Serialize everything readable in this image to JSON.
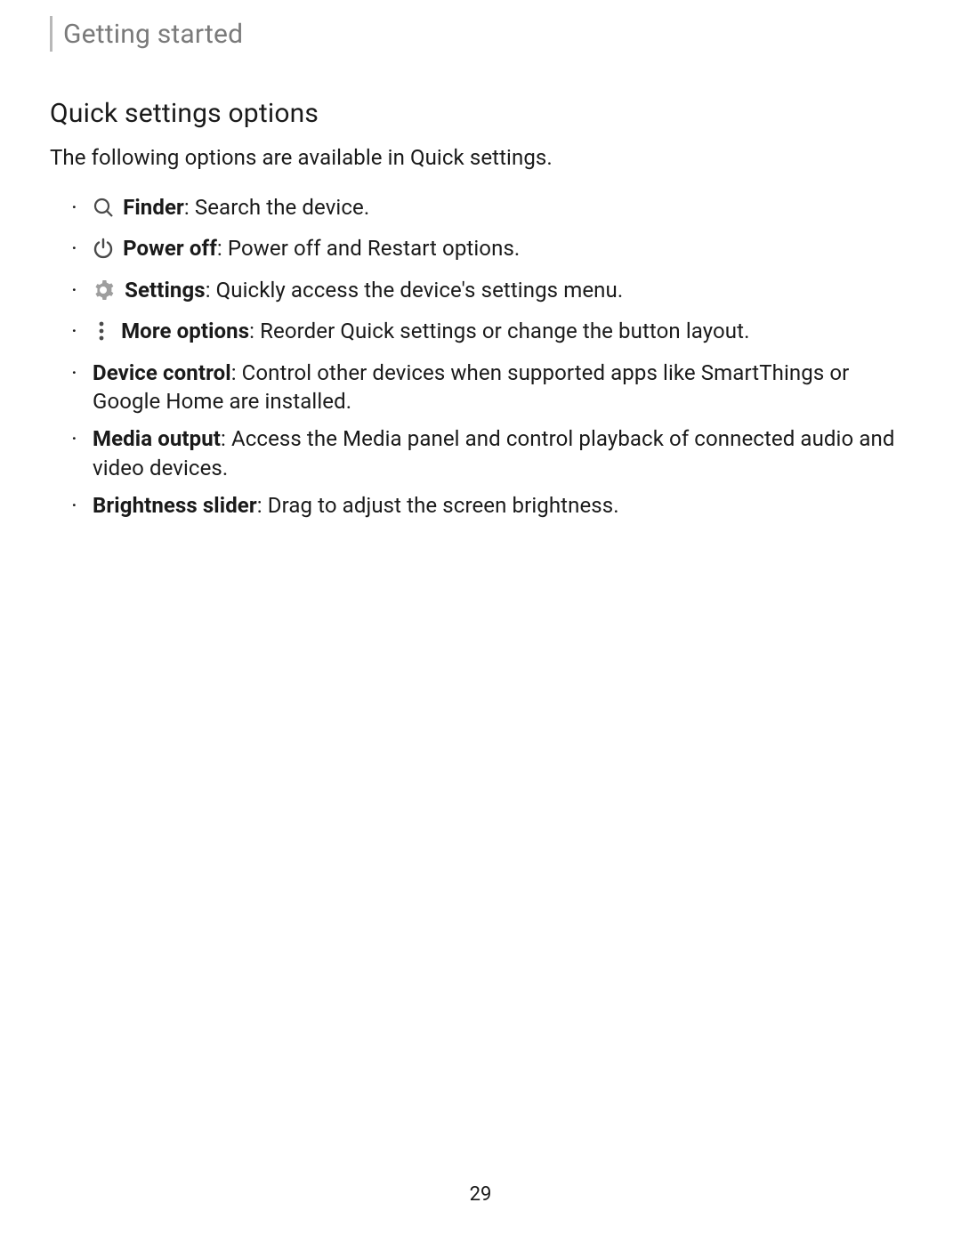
{
  "header": {
    "title": "Getting started"
  },
  "section": {
    "title": "Quick settings options",
    "intro": "The following options are available in Quick settings."
  },
  "options": [
    {
      "icon": "search-icon",
      "label": "Finder",
      "desc": ": Search the device."
    },
    {
      "icon": "power-icon",
      "label": "Power off",
      "desc": ": Power off and Restart options."
    },
    {
      "icon": "gear-icon",
      "label": "Settings",
      "desc": ": Quickly access the device's settings menu."
    },
    {
      "icon": "more-icon",
      "label": "More options",
      "desc": ": Reorder Quick settings or change the button layout."
    },
    {
      "icon": null,
      "label": "Device control",
      "desc": ": Control other devices when supported apps like SmartThings or Google Home are installed."
    },
    {
      "icon": null,
      "label": "Media output",
      "desc": ": Access the Media panel and control playback of connected audio and video devices."
    },
    {
      "icon": null,
      "label": "Brightness slider",
      "desc": ": Drag to adjust the screen brightness."
    }
  ],
  "page_number": "29"
}
